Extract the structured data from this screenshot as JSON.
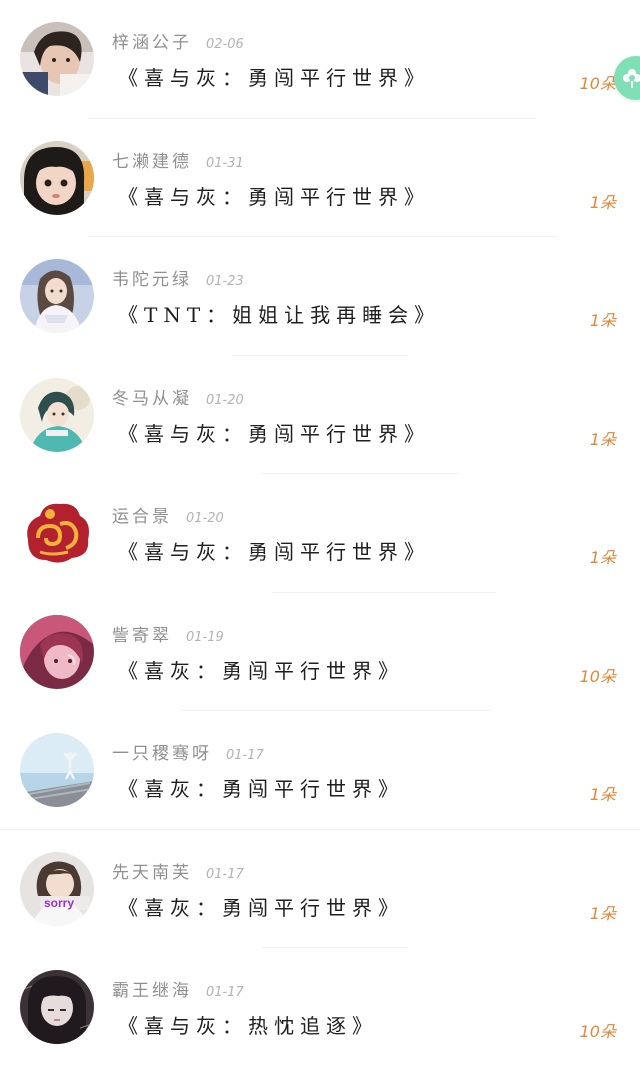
{
  "gifts": [
    {
      "user": "梓涵公子",
      "date": "02-06",
      "title": "《喜与灰：勇闯平行世界》",
      "amount": "10朵",
      "avatar_icon": "girl-portrait-avatar"
    },
    {
      "user": "七濑建德",
      "date": "01-31",
      "title": "《喜与灰：勇闯平行世界》",
      "amount": "1朵",
      "avatar_icon": "girl-selfie-avatar"
    },
    {
      "user": "韦陀元绿",
      "date": "01-23",
      "title": "《TNT：姐姐让我再睡会》",
      "amount": "1朵",
      "avatar_icon": "lolita-girl-avatar"
    },
    {
      "user": "冬马从凝",
      "date": "01-20",
      "title": "《喜与灰：勇闯平行世界》",
      "amount": "1朵",
      "avatar_icon": "anime-girl-avatar"
    },
    {
      "user": "运合景",
      "date": "01-20",
      "title": "《喜与灰：勇闯平行世界》",
      "amount": "1朵",
      "avatar_icon": "auspicious-cloud-avatar"
    },
    {
      "user": "訾寄翠",
      "date": "01-19",
      "title": "《喜灰：勇闯平行世界》",
      "amount": "10朵",
      "avatar_icon": "pink-anime-avatar"
    },
    {
      "user": "一只稷骞呀",
      "date": "01-17",
      "title": "《喜灰：勇闯平行世界》",
      "amount": "1朵",
      "avatar_icon": "yoga-sea-avatar"
    },
    {
      "user": "先天南芙",
      "date": "01-17",
      "title": "《喜灰：勇闯平行世界》",
      "amount": "1朵",
      "avatar_icon": "sorry-girl-avatar"
    },
    {
      "user": "霸王继海",
      "date": "01-17",
      "title": "《喜与灰：热忱追逐》",
      "amount": "10朵",
      "avatar_icon": "dark-anime-avatar"
    }
  ],
  "colors": {
    "amount": "#e0873a",
    "name": "#8f8f8f",
    "date": "#b3b3b3",
    "title": "#1f1f1f",
    "float_button": "#7ee0b4"
  },
  "float_button_icon": "flower-gift-icon"
}
